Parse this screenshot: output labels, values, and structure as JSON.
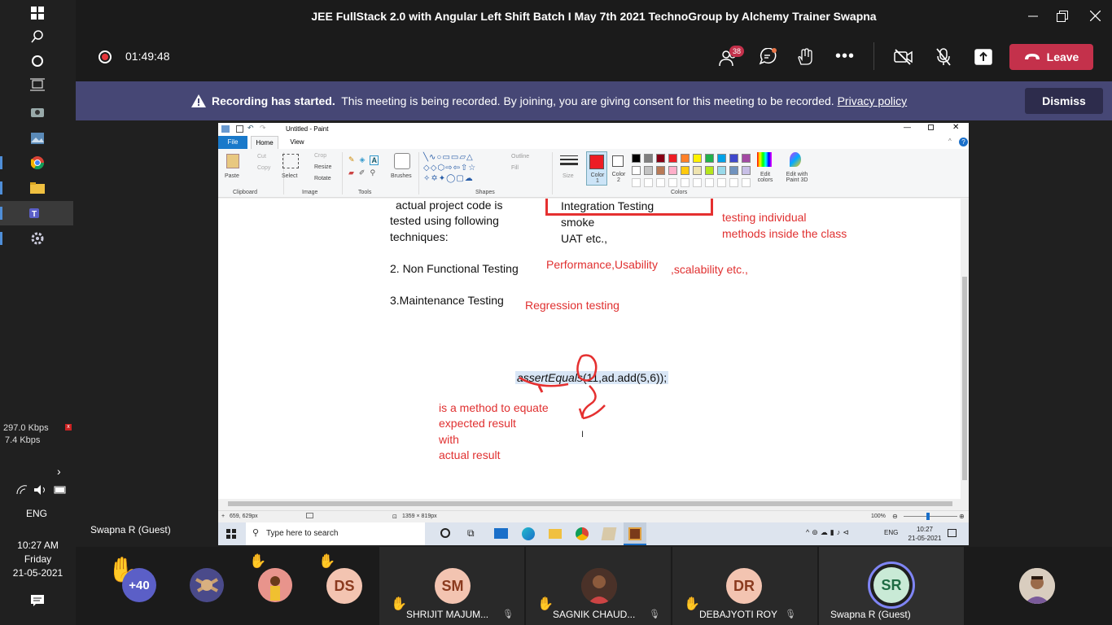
{
  "window": {
    "title": "JEE FullStack 2.0 with Angular Left Shift Batch I May 7th 2021 TechnoGroup by Alchemy Trainer Swapna"
  },
  "header": {
    "recording_time": "01:49:48",
    "people_badge": "38",
    "leave_label": "Leave"
  },
  "banner": {
    "bold": "Recording has started.",
    "text": "This meeting is being recorded. By joining, you are giving consent for this meeting to be recorded.",
    "link": "Privacy policy",
    "dismiss": "Dismiss"
  },
  "sidebar": {
    "net_down": "297.0 Kbps",
    "net_up": "7.4 Kbps",
    "lang": "ENG",
    "time": "10:27 AM",
    "day": "Friday",
    "date": "21-05-2021"
  },
  "presenter_label": "Swapna R (Guest)",
  "paint": {
    "title": "Untitled - Paint",
    "tabs": [
      "File",
      "Home",
      "View"
    ],
    "clipboard": {
      "paste": "Paste",
      "cut": "Cut",
      "copy": "Copy",
      "group": "Clipboard"
    },
    "image": {
      "select": "Select",
      "crop": "Crop",
      "resize": "Resize",
      "rotate": "Rotate",
      "group": "Image"
    },
    "tools": {
      "group": "Tools"
    },
    "brushes": "Brushes",
    "shapes": {
      "outline": "Outline",
      "fill": "Fill",
      "group": "Shapes"
    },
    "size": "Size",
    "color1": "Color 1",
    "color2": "Color 2",
    "colors_group": "Colors",
    "edit_colors": "Edit colors",
    "edit_paint3d": "Edit with Paint 3D",
    "palette": [
      "#000000",
      "#7f7f7f",
      "#880015",
      "#ed1c24",
      "#ff7f27",
      "#fff200",
      "#22b14c",
      "#00a2e8",
      "#3f48cc",
      "#a349a4",
      "#ffffff",
      "#c3c3c3",
      "#b97a57",
      "#ffaec9",
      "#ffc90e",
      "#efe4b0",
      "#b5e61d",
      "#99d9ea",
      "#7092be",
      "#c8bfe7"
    ],
    "status": {
      "cursor": "659, 629px",
      "size": "1359 × 819px",
      "zoom": "100%"
    },
    "canvas": {
      "l1": "actual project code is",
      "l2": "tested using following",
      "l3": "techniques:",
      "integration": "Integration Testing",
      "smoke": "smoke",
      "uat": "UAT etc.,",
      "testing_individual_1": "testing individual",
      "testing_individual_2": "methods inside the class",
      "non_functional": "2. Non Functional Testing",
      "performance": "Performance,Usability",
      "scalability": ",scalability etc.,",
      "maintenance": "3.Maintenance Testing",
      "regression": "Regression testing",
      "code_method": "assertEquals",
      "code_rest": "(11,",
      "code_call": "ad.add(5,6));",
      "note1": "is a method to equate",
      "note2": "expected result",
      "note3": "with",
      "note4": "actual result"
    },
    "taskbar": {
      "search": "Type here to search",
      "lang": "ENG",
      "time": "10:27",
      "date": "21-05-2021"
    }
  },
  "gallery": {
    "overflow": "+40",
    "tiles": [
      {
        "initials": "SM",
        "name": "SHRIJIT MAJUM...",
        "bg": "#f3c4b1",
        "fg": "#8a3a1e"
      },
      {
        "initials": "",
        "name": "SAGNIK CHAUD...",
        "bg": "",
        "fg": ""
      },
      {
        "initials": "DR",
        "name": "DEBAJYOTI ROY",
        "bg": "#f3c4b1",
        "fg": "#8a3a1e"
      },
      {
        "initials": "SR",
        "name": "Swapna R (Guest)",
        "bg": "#c9ead6",
        "fg": "#1e6b43"
      }
    ],
    "small": [
      {
        "initials": "DS"
      }
    ]
  }
}
